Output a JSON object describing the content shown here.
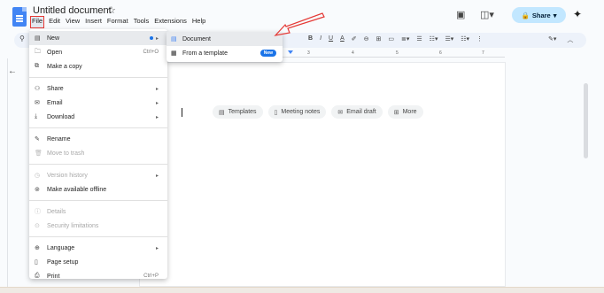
{
  "app": {
    "title": "Untitled document",
    "star_icon": "☆",
    "menus": [
      "File",
      "Edit",
      "View",
      "Insert",
      "Format",
      "Tools",
      "Extensions",
      "Help"
    ],
    "share_label": "Share",
    "colors": {
      "accent": "#1a73e8",
      "share_bg": "#c2e7ff",
      "annotation": "#e53935",
      "docs_blue": "#4285f4"
    }
  },
  "file_menu": {
    "items": [
      {
        "label": "New",
        "icon": "new-doc-icon",
        "glyph": "▤",
        "has_submenu": true,
        "highlighted": true
      },
      {
        "label": "Open",
        "icon": "folder-icon",
        "glyph": "🗀",
        "shortcut": "Ctrl+O"
      },
      {
        "label": "Make a copy",
        "icon": "copy-icon",
        "glyph": "⧉"
      },
      {
        "label": "Share",
        "icon": "person-add-icon",
        "glyph": "⚇",
        "has_submenu": true
      },
      {
        "label": "Email",
        "icon": "email-icon",
        "glyph": "✉",
        "has_submenu": true
      },
      {
        "label": "Download",
        "icon": "download-icon",
        "glyph": "⤓",
        "has_submenu": true
      },
      {
        "label": "Rename",
        "icon": "pencil-icon",
        "glyph": "✎"
      },
      {
        "label": "Move to trash",
        "icon": "trash-icon",
        "glyph": "🗑",
        "disabled": true
      },
      {
        "label": "Version history",
        "icon": "history-icon",
        "glyph": "◷",
        "has_submenu": true,
        "disabled": true
      },
      {
        "label": "Make available offline",
        "icon": "offline-icon",
        "glyph": "⊚"
      },
      {
        "label": "Details",
        "icon": "info-icon",
        "glyph": "ⓘ",
        "disabled": true
      },
      {
        "label": "Security limitations",
        "icon": "security-icon",
        "glyph": "⊙",
        "disabled": true
      },
      {
        "label": "Language",
        "icon": "globe-icon",
        "glyph": "⊕",
        "has_submenu": true
      },
      {
        "label": "Page setup",
        "icon": "page-icon",
        "glyph": "▯"
      },
      {
        "label": "Print",
        "icon": "print-icon",
        "glyph": "⎙",
        "shortcut": "Ctrl+P"
      }
    ]
  },
  "new_submenu": {
    "items": [
      {
        "label": "Document",
        "icon": "docs-icon",
        "glyph": "▤"
      },
      {
        "label": "From a template",
        "icon": "template-icon",
        "glyph": "▦",
        "badge": "New"
      }
    ]
  },
  "chips": [
    {
      "label": "Templates",
      "icon": "template-icon",
      "glyph": "▤"
    },
    {
      "label": "Meeting notes",
      "icon": "notes-icon",
      "glyph": "▯"
    },
    {
      "label": "Email draft",
      "icon": "email-draft-icon",
      "glyph": "✉"
    },
    {
      "label": "More",
      "icon": "more-icon",
      "glyph": "⊞"
    }
  ],
  "ruler_numbers": [
    "1",
    "2",
    "3",
    "4",
    "5",
    "6",
    "7"
  ]
}
